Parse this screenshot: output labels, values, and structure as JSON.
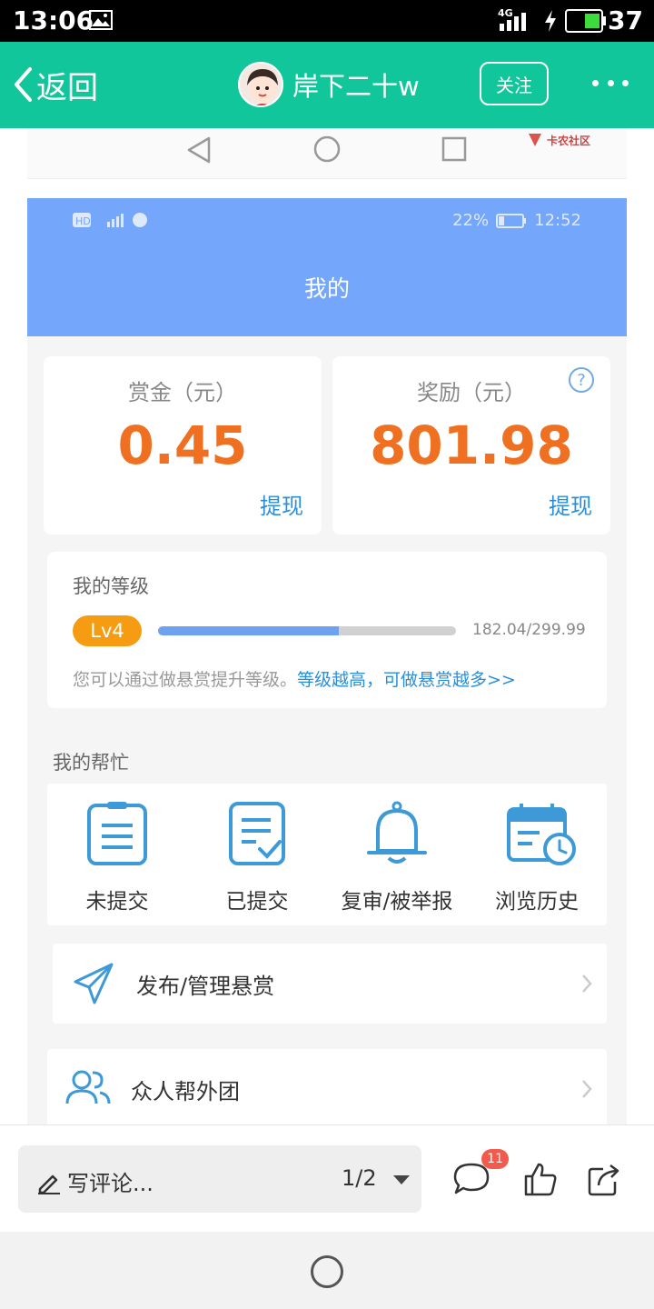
{
  "status_bar": {
    "time": "13:06",
    "network": "4G",
    "battery_percent": "37"
  },
  "header": {
    "back_label": "返回",
    "username": "岸下二十w",
    "follow_label": "关注",
    "accent_color": "#12c69b"
  },
  "embedded": {
    "watermark": "卡农社区",
    "status_right": "22%",
    "status_time": "12:52",
    "page_title": "我的",
    "bounty_card": {
      "label": "赏金（元）",
      "value": "0.45",
      "link": "提现"
    },
    "reward_card": {
      "label": "奖励（元）",
      "value": "801.98",
      "link": "提现",
      "help_icon": "?"
    },
    "level": {
      "title": "我的等级",
      "badge": "Lv4",
      "progress_text": "182.04/299.99",
      "progress_fraction": 0.607,
      "hint_prefix": "您可以通过做悬赏提升等级。",
      "hint_link": "等级越高，可做悬赏越多>>"
    },
    "my_help": {
      "title": "我的帮忙",
      "items": [
        {
          "label": "未提交",
          "icon": "clipboard-icon"
        },
        {
          "label": "已提交",
          "icon": "document-check-icon"
        },
        {
          "label": "复审/被举报",
          "icon": "bell-icon"
        },
        {
          "label": "浏览历史",
          "icon": "calendar-clock-icon"
        }
      ]
    },
    "rows": [
      {
        "label": "发布/管理悬赏",
        "icon": "paper-plane-icon"
      },
      {
        "label": "众人帮外团",
        "icon": "users-icon"
      }
    ]
  },
  "bottom_bar": {
    "comment_placeholder": "写评论...",
    "page_indicator": "1/2",
    "comment_count": "11"
  }
}
